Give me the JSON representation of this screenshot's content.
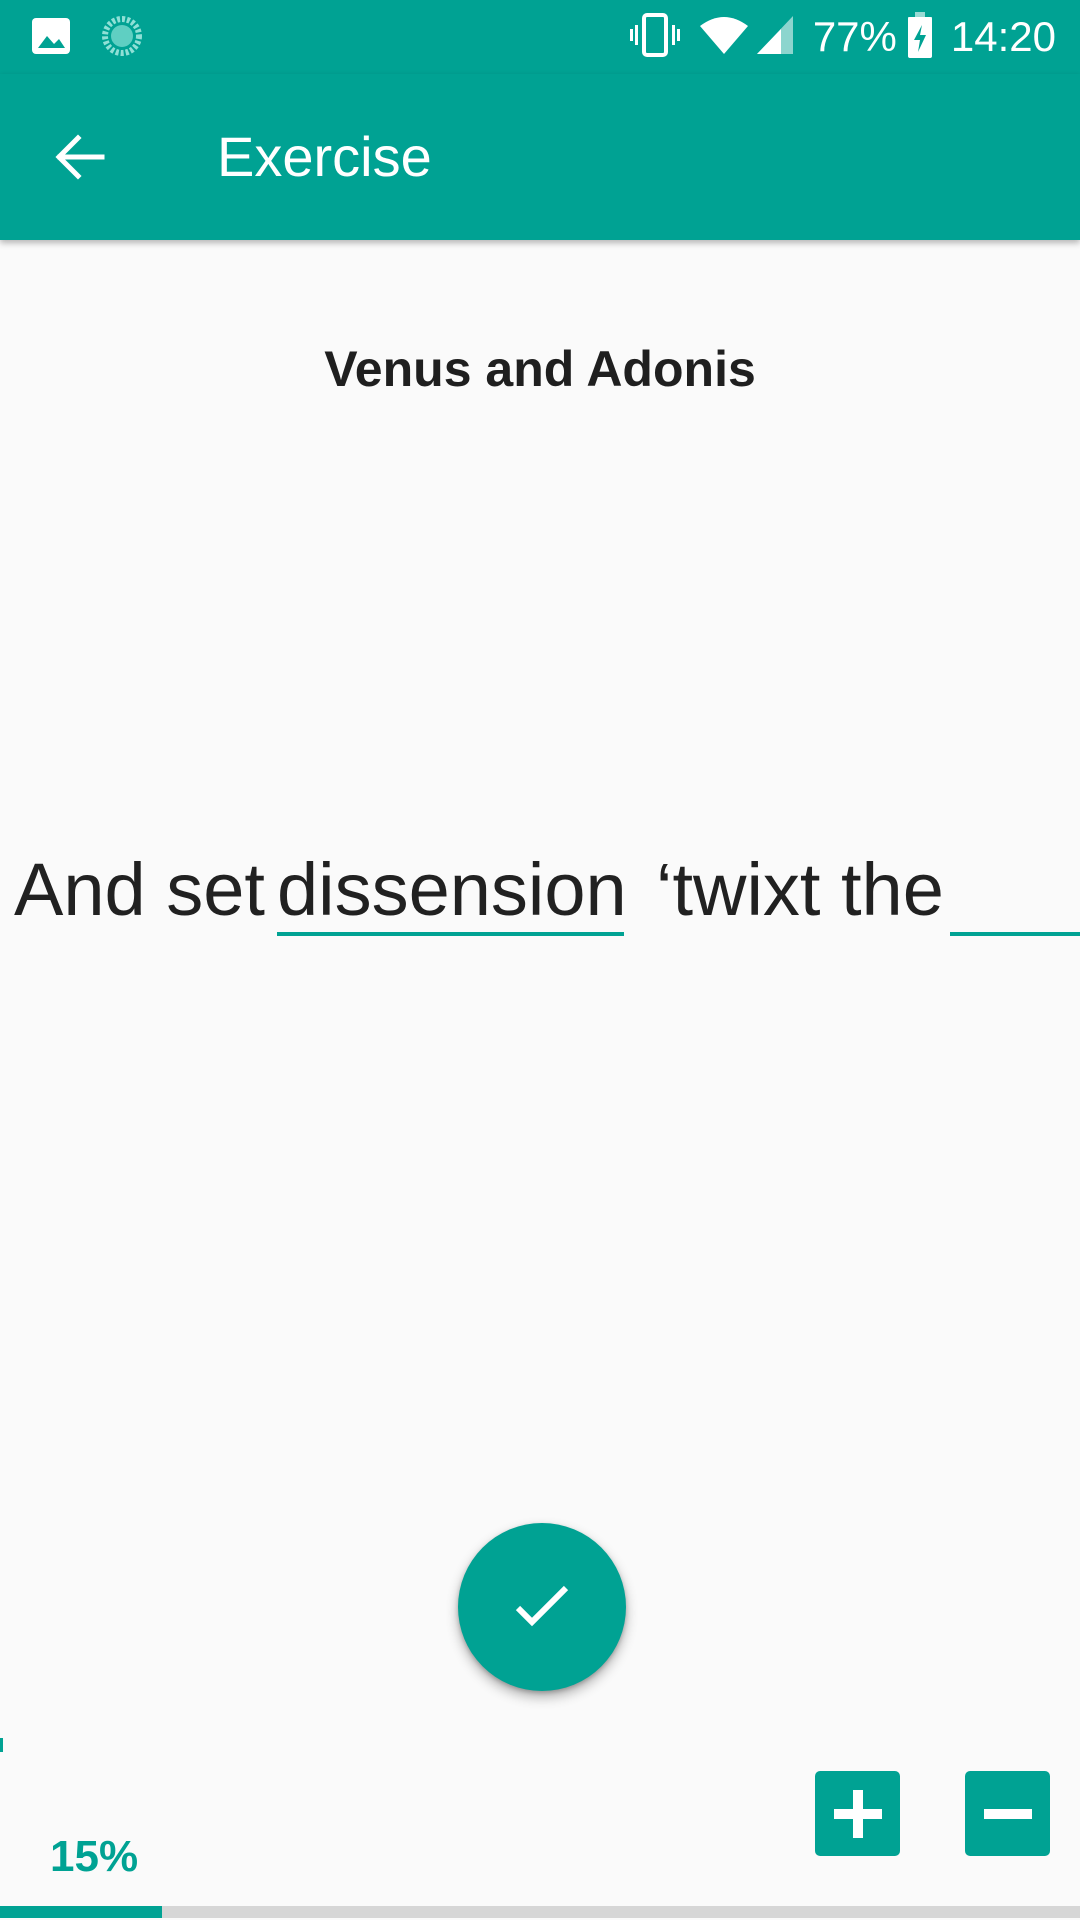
{
  "status_bar": {
    "battery": "77%",
    "time": "14:20",
    "icons": [
      "gallery-icon",
      "sync-icon",
      "vibrate-icon",
      "wifi-icon",
      "signal-icon",
      "battery-charging-icon"
    ]
  },
  "app_bar": {
    "title": "Exercise",
    "back_icon": "arrow-back-icon"
  },
  "exercise": {
    "poem_title": "Venus and Adonis",
    "line_before": "And set",
    "filled_word": "dissension",
    "line_after": "‘twixt the",
    "blank_value": ""
  },
  "controls": {
    "submit_icon": "check-icon",
    "increase_icon": "plus-icon",
    "decrease_icon": "minus-icon"
  },
  "progress": {
    "label": "15%",
    "value": 0.15
  },
  "colors": {
    "primary": "#00A293",
    "background": "#FAFAFA",
    "text": "#212121",
    "track": "#D6D6D6"
  }
}
